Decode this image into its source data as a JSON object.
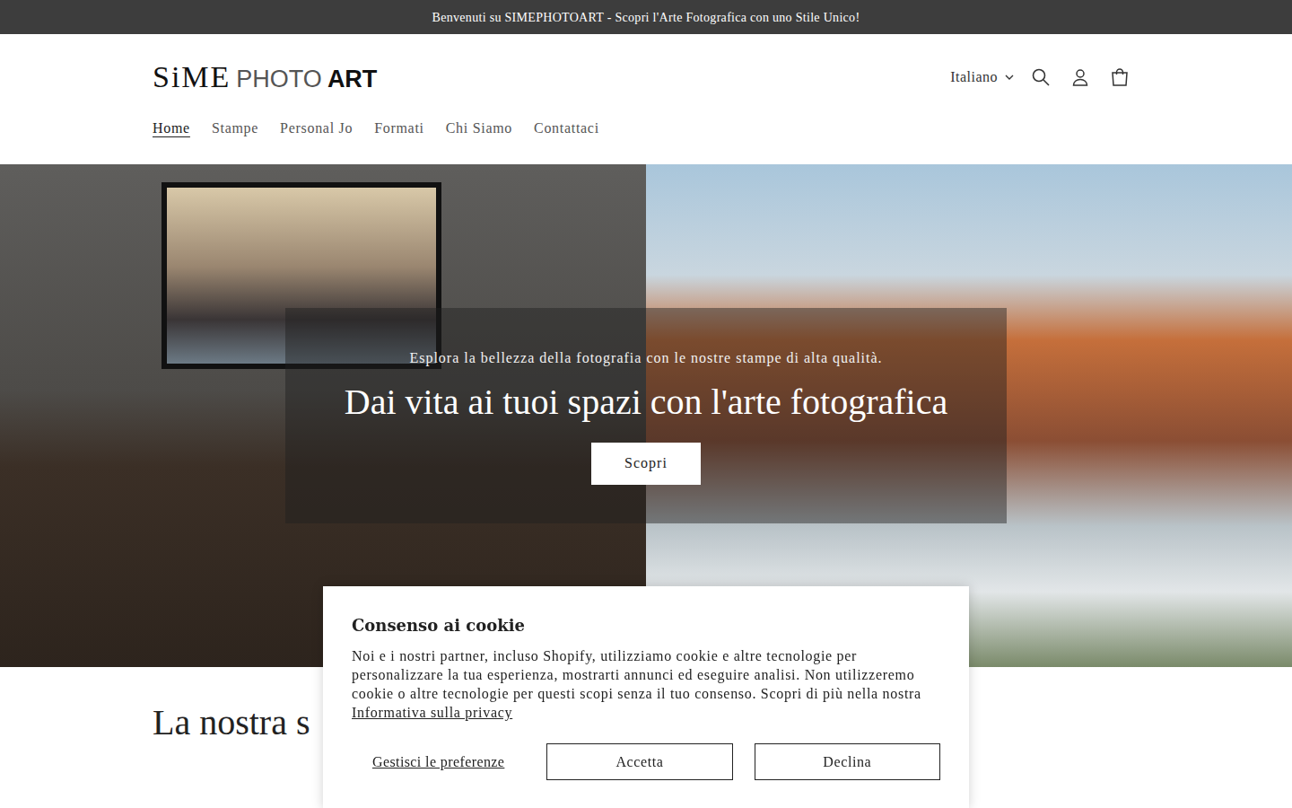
{
  "announcement": "Benvenuti su SIMEPHOTOART - Scopri l'Arte Fotografica con uno Stile Unico!",
  "logo": {
    "parts": [
      "SiME",
      "PHOTO",
      "ART"
    ]
  },
  "header": {
    "language": "Italiano"
  },
  "nav": [
    {
      "label": "Home",
      "selected": true
    },
    {
      "label": "Stampe",
      "selected": false
    },
    {
      "label": "Personal Jo",
      "selected": false
    },
    {
      "label": "Formati",
      "selected": false
    },
    {
      "label": "Chi Siamo",
      "selected": false
    },
    {
      "label": "Contattaci",
      "selected": false
    }
  ],
  "hero": {
    "subtitle": "Esplora la bellezza della fotografia con le nostre stampe di alta qualità.",
    "title": "Dai vita ai tuoi spazi con l'arte fotografica",
    "button": "Scopri"
  },
  "section": {
    "title": "La nostra s"
  },
  "cookie": {
    "title": "Consenso ai cookie",
    "text": "Noi e i nostri partner, incluso Shopify, utilizziamo cookie e altre tecnologie per personalizzare la tua esperienza, mostrarti annunci ed eseguire analisi. Non utilizzeremo cookie o altre tecnologie per questi scopi senza il tuo consenso. Scopri di più nella nostra ",
    "link": "Informativa sulla privacy",
    "buttons": [
      "Gestisci le preferenze",
      "Accetta",
      "Declina"
    ]
  }
}
